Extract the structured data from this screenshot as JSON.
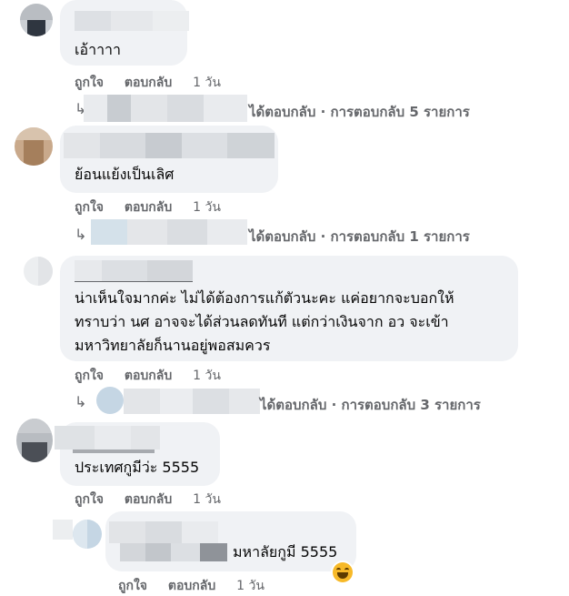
{
  "comments": [
    {
      "text_lines": [
        "เอ้าาาา"
      ],
      "actions": {
        "like": "ถูกใจ",
        "reply": "ตอบกลับ",
        "time": "1 วัน"
      },
      "replies_summary": "ได้ตอบกลับ · การตอบกลับ 5 รายการ"
    },
    {
      "text_lines": [
        "ย้อนแย้งเป็นเลิศ"
      ],
      "actions": {
        "like": "ถูกใจ",
        "reply": "ตอบกลับ",
        "time": "1 วัน"
      },
      "replies_summary": "ได้ตอบกลับ · การตอบกลับ 1 รายการ"
    },
    {
      "text_lines": [
        "น่าเห็นใจมากค่ะ ไม่ได้ต้องการแก้ตัวนะคะ แค่อยากจะบอกให้",
        "ทราบว่า นศ อาจจะได้ส่วนลดทันที แต่กว่าเงินจาก อว จะเข้า",
        "มหาวิทยาลัยก็นานอยู่พอสมควร"
      ],
      "actions": {
        "like": "ถูกใจ",
        "reply": "ตอบกลับ",
        "time": "1 วัน"
      },
      "replies_summary": "ได้ตอบกลับ · การตอบกลับ 3 รายการ"
    },
    {
      "text_lines": [
        "ประเทศกูมีว่ะ 5555"
      ],
      "actions": {
        "like": "ถูกใจ",
        "reply": "ตอบกลับ",
        "time": "1 วัน"
      }
    },
    {
      "text_lines": [
        "มหาลัยกูมี 5555"
      ],
      "actions": {
        "like": "ถูกใจ",
        "reply": "ตอบกลับ",
        "time": "1 วัน"
      },
      "reaction_icon": "laughing-emoji-icon"
    }
  ],
  "colors": {
    "bubble": "#f0f2f5",
    "meta_text": "#65676b",
    "body_text": "#050505",
    "emoji": "#f7b928"
  }
}
